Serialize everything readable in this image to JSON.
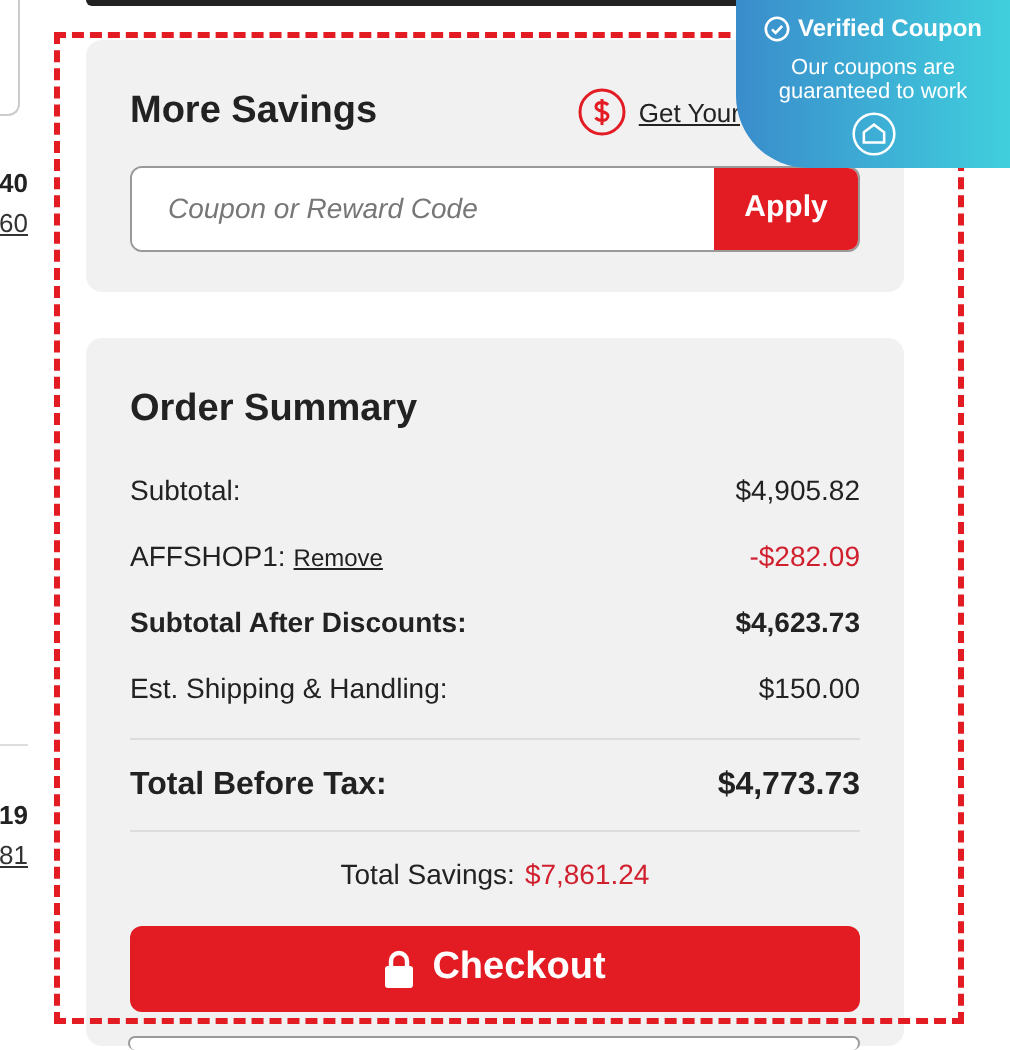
{
  "side_fragments": [
    {
      "text": "40",
      "kind": "bold"
    },
    {
      "text": "60",
      "kind": "link"
    },
    {
      "text": "19",
      "kind": "bold"
    },
    {
      "text": "81",
      "kind": "link"
    }
  ],
  "more_savings": {
    "title": "More Savings",
    "rewards_link": "Get Your",
    "coupon_field": {
      "placeholder": "Coupon or Reward Code"
    },
    "apply_button": "Apply"
  },
  "order_summary": {
    "title": "Order Summary",
    "rows": [
      {
        "label": "Subtotal:",
        "value": "$4,905.82",
        "kind": "plain"
      },
      {
        "label": "AFFSHOP1:",
        "link": "Remove",
        "value": "-$282.09",
        "kind": "discount"
      },
      {
        "label": "Subtotal After Discounts:",
        "value": "$4,623.73",
        "kind": "bold"
      },
      {
        "label": "Est. Shipping & Handling:",
        "value": "$150.00",
        "kind": "plain"
      }
    ],
    "total": {
      "label": "Total Before Tax:",
      "value": "$4,773.73"
    },
    "savings": {
      "label": "Total Savings:",
      "value": "$7,861.24"
    },
    "checkout_button": "Checkout"
  },
  "coupon_badge": {
    "title": "Verified Coupon",
    "text": "Our coupons are guaranteed to work"
  }
}
